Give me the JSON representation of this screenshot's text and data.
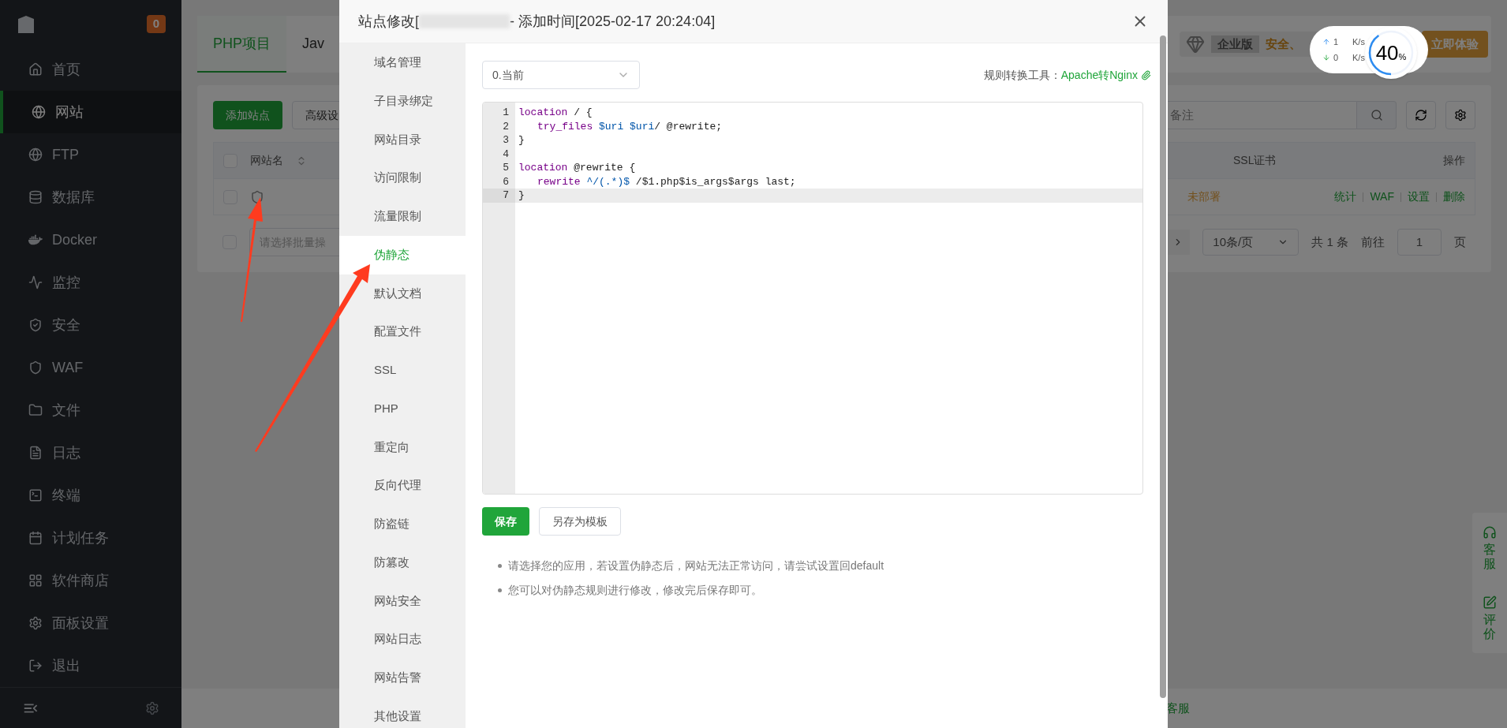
{
  "sidebar": {
    "badge": "0",
    "items": [
      {
        "label": "首页",
        "selected": false
      },
      {
        "label": "网站",
        "selected": true
      },
      {
        "label": "FTP",
        "selected": false
      },
      {
        "label": "数据库",
        "selected": false
      },
      {
        "label": "Docker",
        "selected": false
      },
      {
        "label": "监控",
        "selected": false
      },
      {
        "label": "安全",
        "selected": false
      },
      {
        "label": "WAF",
        "selected": false
      },
      {
        "label": "文件",
        "selected": false
      },
      {
        "label": "日志",
        "selected": false
      },
      {
        "label": "终端",
        "selected": false
      },
      {
        "label": "计划任务",
        "selected": false
      },
      {
        "label": "软件商店",
        "selected": false
      },
      {
        "label": "面板设置",
        "selected": false
      },
      {
        "label": "退出",
        "selected": false
      }
    ]
  },
  "page": {
    "tabs": [
      {
        "label": "PHP项目",
        "selected": true
      },
      {
        "label": "Jav",
        "selected": false
      }
    ],
    "promo": {
      "badge": "企业版",
      "text": "安全、",
      "button": "立即体验"
    },
    "toolbar": {
      "buttons": [
        "添加站点",
        "高级设"
      ],
      "search_placeholder": "备注"
    },
    "table": {
      "all_checked": false,
      "columns": [
        "网站名",
        "SSL证书",
        "操作"
      ],
      "rows": [
        {
          "checked": false,
          "ssl": "未部署",
          "actions": [
            "统计",
            "WAF",
            "设置",
            "删除"
          ]
        }
      ]
    },
    "pagination": {
      "checked": false,
      "batch_placeholder": "请选择批量操",
      "page_size": "10条/页",
      "total": "共 1 条",
      "goto_label": "前往",
      "page": "1",
      "page_suffix": "页"
    },
    "footer_link": "客服"
  },
  "float_panel": [
    {
      "kind": "support",
      "label": "客服"
    },
    {
      "kind": "review",
      "label": "评价"
    }
  ],
  "net_widget": {
    "up": "1",
    "down": "0",
    "up_unit": "K/s",
    "down_unit": "K/s",
    "load": "40",
    "percent": "%",
    "level": 0.4
  },
  "modal": {
    "title_prefix": "站点修改[",
    "title_suffix": "- 添加时间[2025-02-17 20:24:04]",
    "nav": [
      {
        "label": "域名管理",
        "selected": false
      },
      {
        "label": "子目录绑定",
        "selected": false
      },
      {
        "label": "网站目录",
        "selected": false
      },
      {
        "label": "访问限制",
        "selected": false
      },
      {
        "label": "流量限制",
        "selected": false
      },
      {
        "label": "伪静态",
        "selected": true
      },
      {
        "label": "默认文档",
        "selected": false
      },
      {
        "label": "配置文件",
        "selected": false
      },
      {
        "label": "SSL",
        "selected": false
      },
      {
        "label": "PHP",
        "selected": false
      },
      {
        "label": "重定向",
        "selected": false
      },
      {
        "label": "反向代理",
        "selected": false
      },
      {
        "label": "防盗链",
        "selected": false
      },
      {
        "label": "防篡改",
        "selected": false
      },
      {
        "label": "网站安全",
        "selected": false
      },
      {
        "label": "网站日志",
        "selected": false
      },
      {
        "label": "网站告警",
        "selected": false
      },
      {
        "label": "其他设置",
        "selected": false
      }
    ],
    "version_select": "0.当前",
    "tool_label": "规则转换工具：",
    "tool_link": "Apache转Nginx",
    "code": [
      {
        "number": "1",
        "selected": false,
        "indented": false,
        "tokens": [
          {
            "kind": "keyword",
            "text": "location"
          },
          {
            "kind": "plain",
            "text": " / {"
          }
        ]
      },
      {
        "number": "2",
        "selected": false,
        "indented": true,
        "tokens": [
          {
            "kind": "keyword",
            "text": "try_files"
          },
          {
            "kind": "variable",
            "text": " $uri"
          },
          {
            "kind": "variable",
            "text": " $uri"
          },
          {
            "kind": "plain",
            "text": "/ @rewrite;"
          }
        ]
      },
      {
        "number": "3",
        "selected": false,
        "indented": false,
        "tokens": [
          {
            "kind": "plain",
            "text": "}"
          }
        ]
      },
      {
        "number": "4",
        "selected": false
      },
      {
        "number": "5",
        "selected": false,
        "indented": false,
        "tokens": [
          {
            "kind": "keyword",
            "text": "location"
          },
          {
            "kind": "plain",
            "text": " @rewrite {"
          }
        ]
      },
      {
        "number": "6",
        "selected": false,
        "indented": true,
        "tokens": [
          {
            "kind": "keyword",
            "text": "rewrite"
          },
          {
            "kind": "variable",
            "text": " ^/(.*)$"
          },
          {
            "kind": "plain",
            "text": " /$1.php$is_args$args last;"
          }
        ]
      },
      {
        "number": "7",
        "selected": true,
        "indented": false,
        "tokens": [
          {
            "kind": "plain",
            "text": "}"
          }
        ]
      }
    ],
    "buttons": [
      {
        "kind": "primary",
        "label": "保存"
      },
      {
        "kind": "default",
        "label": "另存为模板"
      }
    ],
    "tips": [
      "请选择您的应用，若设置伪静态后，网站无法正常访问，请尝试设置回default",
      "您可以对伪静态规则进行修改，修改完后保存即可。"
    ]
  }
}
